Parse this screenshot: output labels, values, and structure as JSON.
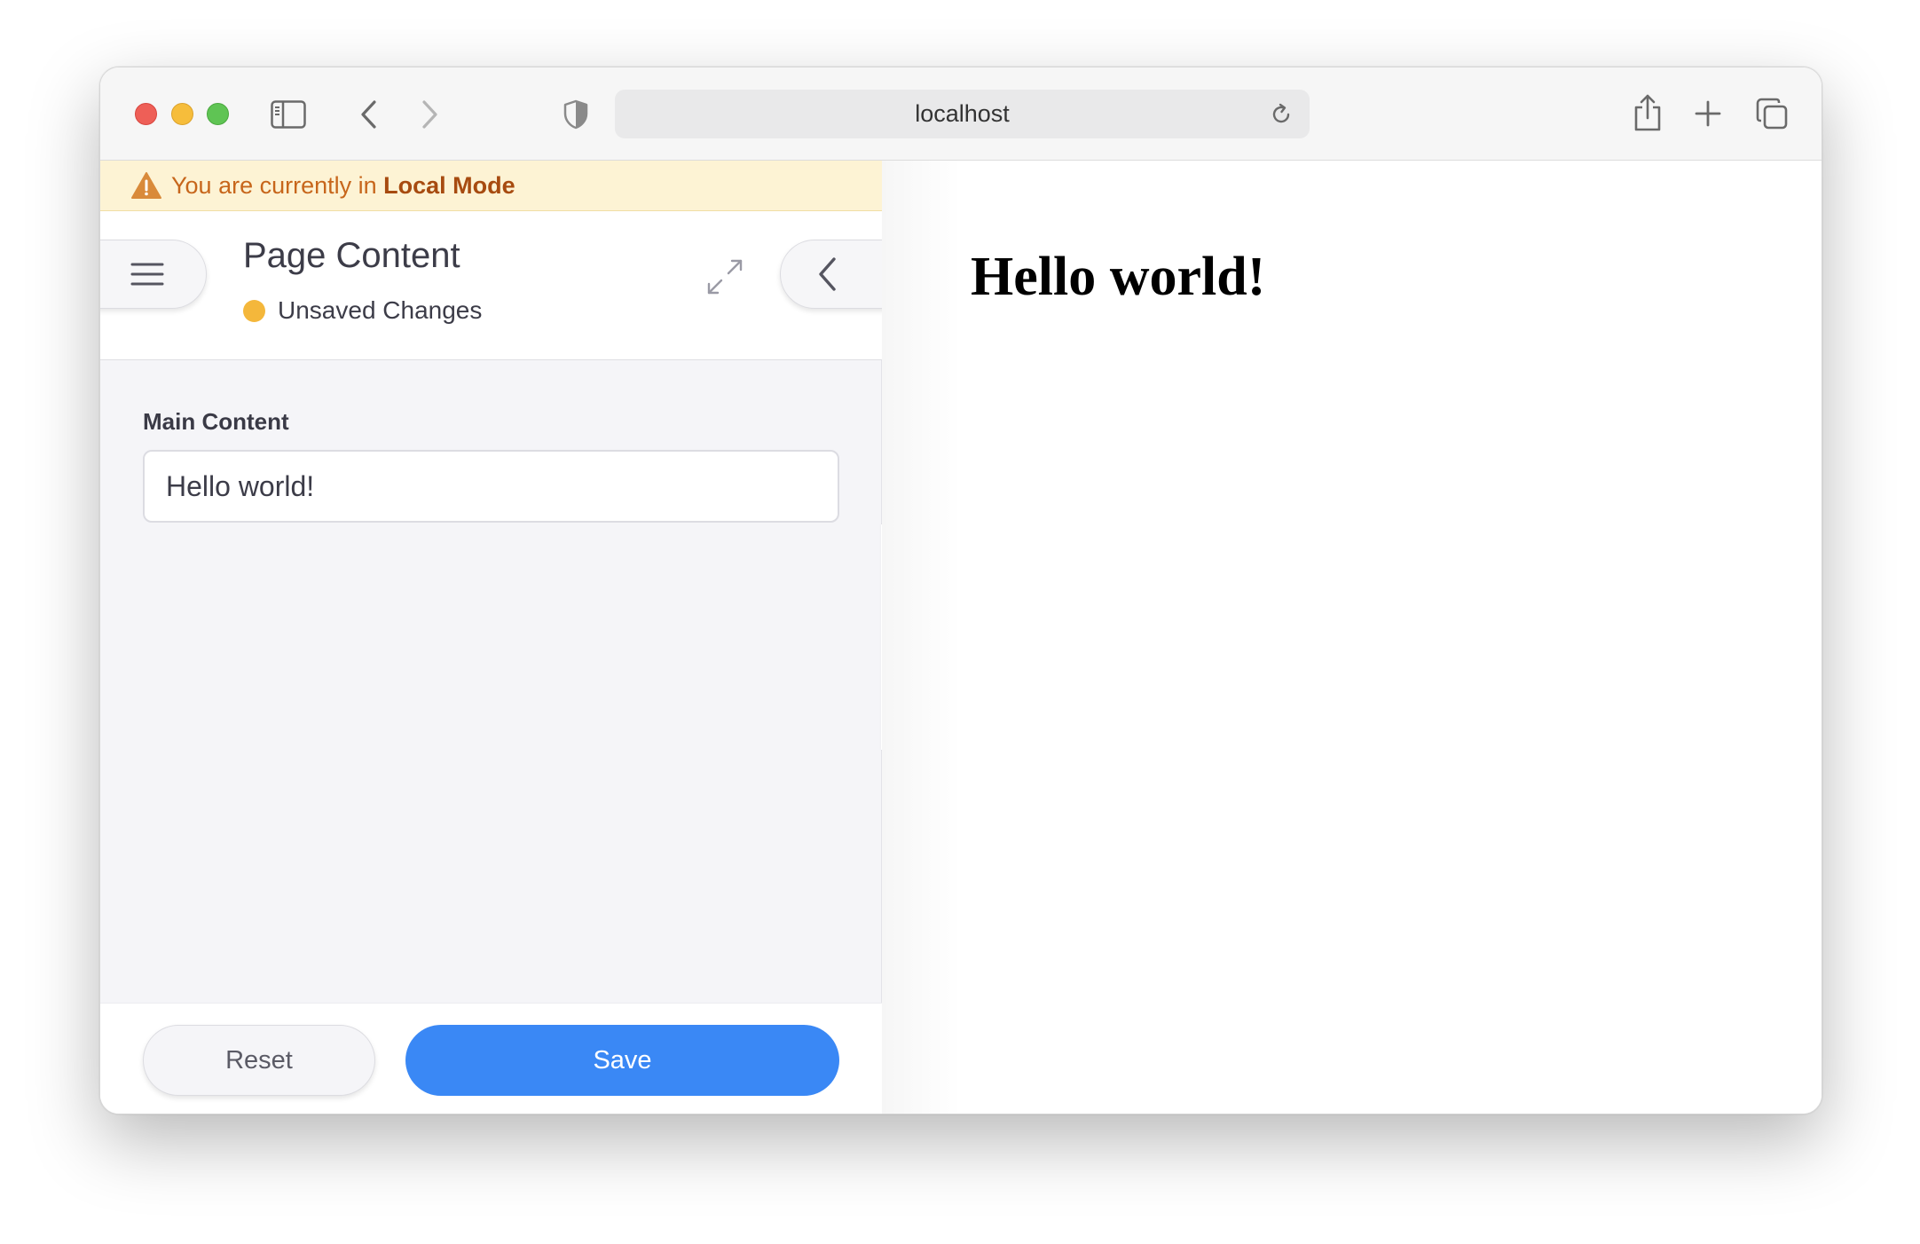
{
  "browser": {
    "address": "localhost",
    "icons": {
      "sidebar": "sidebar-icon",
      "back": "chevron-left-icon",
      "forward": "chevron-right-icon",
      "privacy": "shield-icon",
      "reload": "reload-icon",
      "share": "share-icon",
      "new_tab": "plus-icon",
      "tab_overview": "tabs-icon"
    }
  },
  "banner": {
    "prefix": "You are currently in ",
    "mode": "Local Mode",
    "icon": "warning-icon",
    "color": "#c7661b"
  },
  "editor": {
    "title": "Page Content",
    "status": "Unsaved Changes",
    "status_color": "#f4b73b",
    "field": {
      "label": "Main Content",
      "value": "Hello world!"
    },
    "buttons": {
      "reset": "Reset",
      "save": "Save"
    },
    "accent": "#3a88f5"
  },
  "preview": {
    "heading": "Hello world!"
  }
}
